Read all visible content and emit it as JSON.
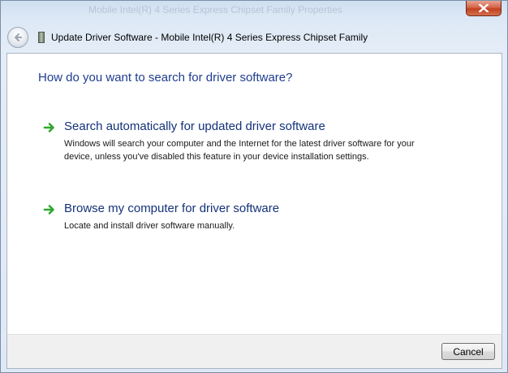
{
  "window": {
    "background_title": "Mobile Intel(R) 4 Series Express Chipset Family Properties",
    "close_icon": "close-icon"
  },
  "header": {
    "back_icon": "back-arrow-icon",
    "device_icon": "device-icon",
    "title": "Update Driver Software - Mobile Intel(R) 4 Series Express Chipset Family"
  },
  "main": {
    "question": "How do you want to search for driver software?",
    "options": [
      {
        "icon": "green-arrow-icon",
        "title": "Search automatically for updated driver software",
        "description": "Windows will search your computer and the Internet for the latest driver software for your device, unless you've disabled this feature in your device installation settings."
      },
      {
        "icon": "green-arrow-icon",
        "title": "Browse my computer for driver software",
        "description": "Locate and install driver software manually."
      }
    ]
  },
  "footer": {
    "cancel_label": "Cancel"
  },
  "colors": {
    "heading": "#1e3d8f",
    "option_title": "#13327a",
    "arrow_green": "#2fa82f",
    "close_red": "#c2401f"
  }
}
